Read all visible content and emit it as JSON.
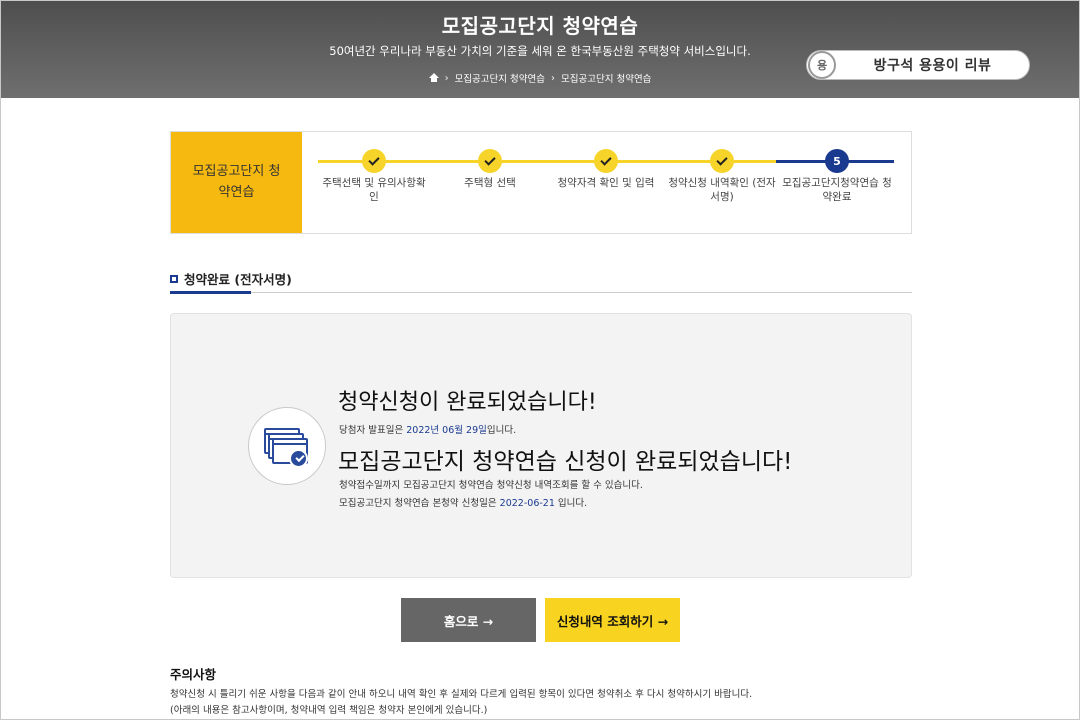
{
  "header": {
    "title": "모집공고단지 청약연습",
    "subtitle": "50여년간 우리나라 부동산 가치의 기준을 세워 온 한국부동산원 주택청약 서비스입니다.",
    "breadcrumb": [
      "모집공고단지 청약연습",
      "모집공고단지 청약연습"
    ]
  },
  "badge": {
    "icon_text": "용",
    "text": "방구석 용용이 리뷰"
  },
  "steps": {
    "label": "모집공고단지 청약연습",
    "items": [
      {
        "label": "주택선택 및 유의사항확인",
        "status": "done"
      },
      {
        "label": "주택형 선택",
        "status": "done"
      },
      {
        "label": "청약자격 확인 및 입력",
        "status": "done"
      },
      {
        "label": "청약신청 내역확인 (전자서명)",
        "status": "done"
      },
      {
        "label": "모집공고단지청약연습 청약완료",
        "status": "current",
        "number": "5"
      }
    ]
  },
  "section": {
    "title": "청약완료 (전자서명)"
  },
  "result": {
    "heading": "청약신청이 완료되었습니다!",
    "announce_prefix": "당첨자 발표일은 ",
    "announce_date": "2022년 06월 29일",
    "announce_suffix": "입니다.",
    "main": "모집공고단지 청약연습 신청이 완료되었습니다!",
    "info": "청약접수일까지 모집공고단지 청약연습 청약신청 내역조회를 할 수 있습니다.",
    "apply_prefix": "모집공고단지 청약연습 본청약 신청일은 ",
    "apply_date": "2022-06-21",
    "apply_suffix": " 입니다."
  },
  "buttons": {
    "home": "홈으로 →",
    "check": "신청내역 조회하기 →"
  },
  "notes": {
    "title": "주의사항",
    "line1": "청약신청 시 틀리기 쉬운 사항을 다음과 같이 안내 하오니 내역 확인 후 실제와 다르게 입력된 항목이 있다면 청약취소 후 다시 청약하시기 바랍니다.",
    "line2": "(아래의 내용은 참고사항이며, 청약내역 입력 책임은 청약자 본인에게 있습니다.)"
  },
  "colors": {
    "accent_yellow": "#f6b90f",
    "step_line": "#f6d42a",
    "navy": "#1a3a8f",
    "header_gray": "#5a5a5a"
  }
}
